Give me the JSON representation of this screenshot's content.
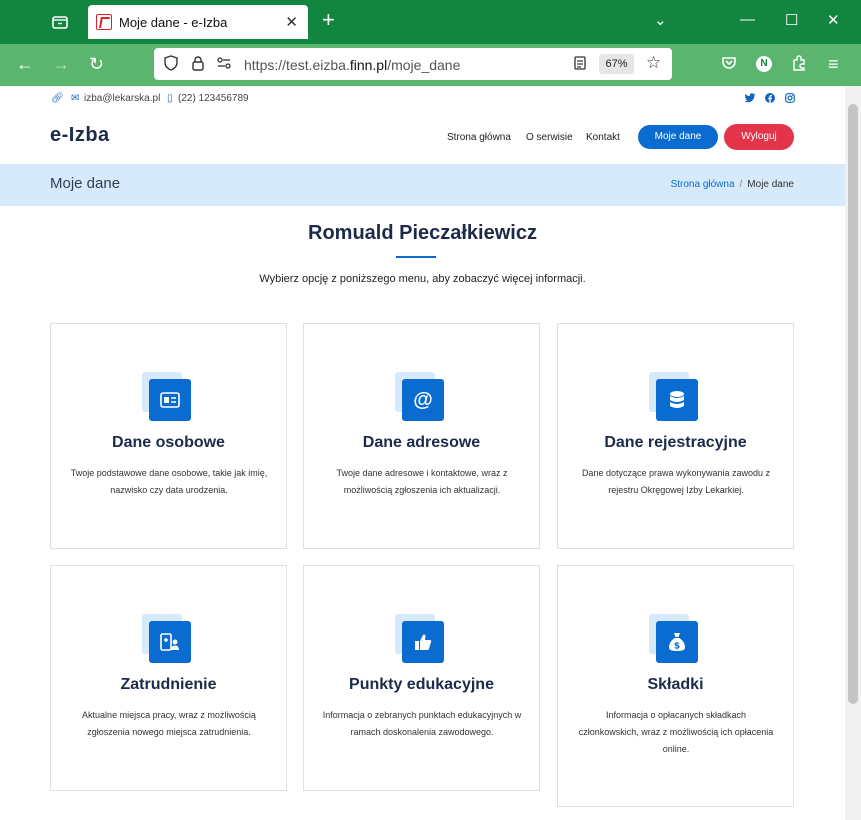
{
  "browser": {
    "tab_title": "Moje dane - e-Izba",
    "url_prefix": "https://test.eizba.",
    "url_domain": "finn.pl",
    "url_path": "/moje_dane",
    "zoom": "67%",
    "profile_initial": "N"
  },
  "topbar": {
    "email": "izba@lekarska.pl",
    "phone": "(22) 123456789"
  },
  "header": {
    "logo": "e-Izba",
    "menu": [
      "Strona główna",
      "O serwisie",
      "Kontakt"
    ],
    "my_data_button": "Moje dane",
    "logout_button": "Wyloguj"
  },
  "hero": {
    "title": "Moje dane",
    "breadcrumb_home": "Strona główna",
    "breadcrumb_sep": "/",
    "breadcrumb_current": "Moje dane"
  },
  "main": {
    "name": "Romuald Pieczałkiewicz",
    "intro": "Wybierz opcję z poniższego menu, aby zobaczyć więcej informacji."
  },
  "cards": [
    {
      "title": "Dane osobowe",
      "desc": "Twoje podstawowe dane osobowe, takie jak imię, nazwisko czy data urodzenia.",
      "icon": "id-card-icon"
    },
    {
      "title": "Dane adresowe",
      "desc": "Twoje dane adresowe i kontaktowe, wraz z możliwością zgłoszenia ich aktualizacji.",
      "icon": "at-sign-icon"
    },
    {
      "title": "Dane rejestracyjne",
      "desc": "Dane dotyczące prawa wykonywania zawodu z rejestru Okręgowej Izby Lekarkiej.",
      "icon": "database-icon"
    },
    {
      "title": "Zatrudnienie",
      "desc": "Aktualne miejsca pracy, wraz z możliwością zgłoszenia nowego miejsca zatrudnienia.",
      "icon": "employee-icon"
    },
    {
      "title": "Punkty edukacyjne",
      "desc": "Informacja o zebranych punktach edukacyjnych w ramach doskonalenia zawodowego.",
      "icon": "thumbs-up-icon"
    },
    {
      "title": "Składki",
      "desc": "Informacja o opłacanych składkach członkowskich, wraz z możliwością ich opłacenia online.",
      "icon": "money-bag-icon"
    }
  ],
  "colors": {
    "accent": "#0a6bd1",
    "danger": "#e3344a",
    "browser": "#12853f",
    "hero_bg": "#d7eafb"
  }
}
